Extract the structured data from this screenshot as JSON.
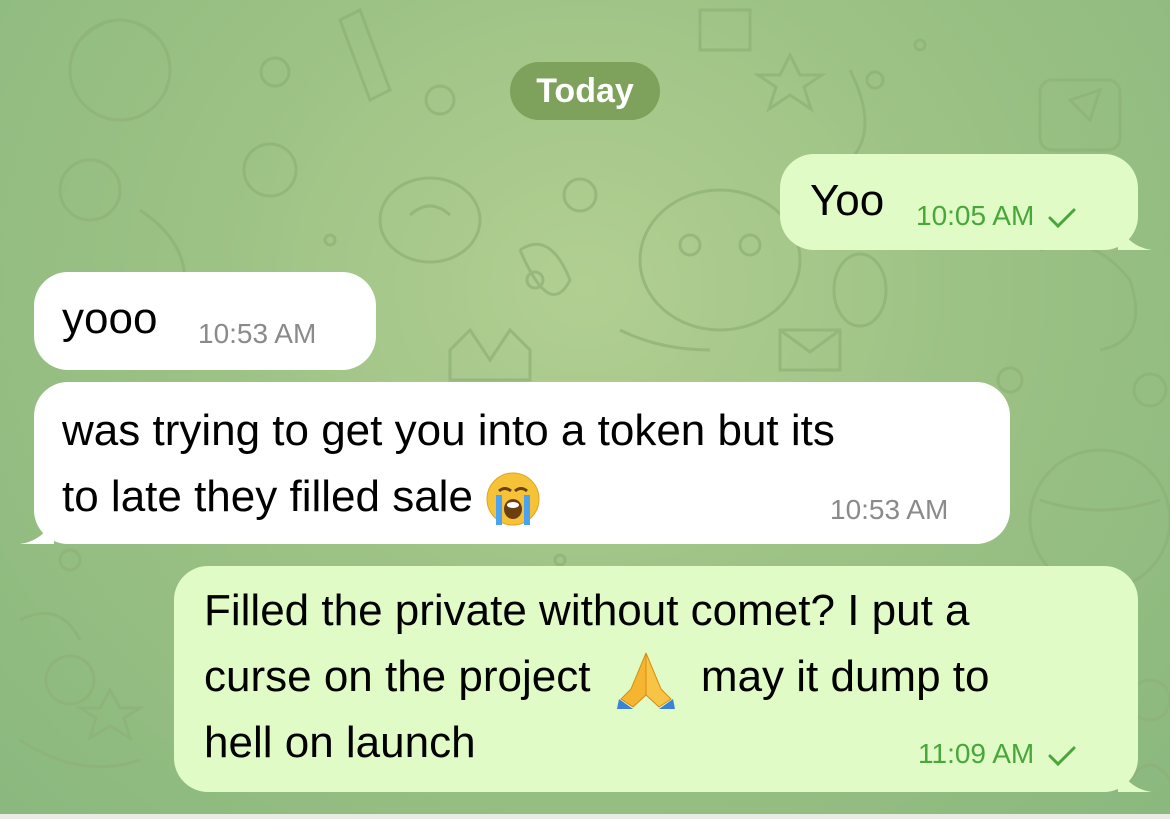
{
  "date_separator": "Today",
  "messages": [
    {
      "direction": "outgoing",
      "lines": [
        "Yoo"
      ],
      "time": "10:05 AM",
      "status": "read-check-icon"
    },
    {
      "direction": "incoming",
      "lines": [
        "yooo"
      ],
      "time": "10:53 AM"
    },
    {
      "direction": "incoming",
      "lines": [
        "was trying to get you into a token but its",
        "to late they filled sale"
      ],
      "emoji": "loudly-crying-face-icon",
      "time": "10:53 AM"
    },
    {
      "direction": "outgoing",
      "lines": [
        "Filled the private without comet? I put a",
        "curse on the project",
        "may it dump to",
        "hell on launch"
      ],
      "emoji": "folded-hands-icon",
      "time": "11:09 AM",
      "status": "read-check-icon"
    }
  ],
  "colors": {
    "outgoing_bubble": "#e0fbc6",
    "incoming_bubble": "#ffffff",
    "outgoing_time": "#49a63a",
    "incoming_time": "#8a8a8a",
    "date_pill": "#7ea25c"
  }
}
